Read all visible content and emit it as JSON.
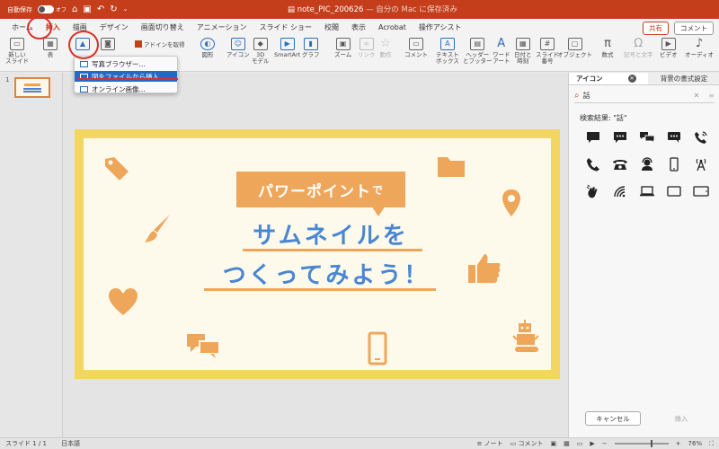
{
  "titlebar": {
    "autosave_label": "自動保存",
    "autosave_state": "オフ",
    "doc_name": "note_PIC_200626",
    "doc_status": "— 自分の Mac に保存済み"
  },
  "menu": {
    "tabs": [
      "ホーム",
      "挿入",
      "描画",
      "デザイン",
      "画面切り替え",
      "アニメーション",
      "スライド ショー",
      "校閲",
      "表示",
      "Acrobat",
      "操作アシスト"
    ],
    "active": "挿入",
    "share_label": "共有",
    "comment_label": "コメント"
  },
  "ribbon": {
    "new_slide": "新しい\nスライド",
    "table": "表",
    "addin": "アドインを取得",
    "shapes": "図形",
    "icons": "アイコン",
    "model3d": "3D\nモデル",
    "smartart": "SmartArt",
    "graph": "グラフ",
    "zoom": "ズーム",
    "link": "リンク",
    "action": "動作",
    "comment": "コメント",
    "textbox": "テキスト\nボックス",
    "header": "ヘッダー\nとフッター",
    "wordart": "ワード\nアート",
    "datetime": "日付と\n時刻",
    "slide_number": "スライド\n番号",
    "object": "オブジェクト",
    "equation": "数式",
    "symbol": "記号と文字",
    "video": "ビデオ",
    "audio": "オーディオ"
  },
  "picture_menu": {
    "items": [
      "写真ブラウザー...",
      "図をファイルから挿入...",
      "オンライン画像..."
    ],
    "highlighted": 1
  },
  "slide_panel": {
    "thumb_number": "1"
  },
  "slide": {
    "bubble_main": "パワーポイント",
    "bubble_small": "で",
    "line1": "サムネイルを",
    "line2": "つくってみよう！",
    "colors": {
      "frame": "#f2d660",
      "bg": "#fdfaec",
      "accent": "#eea65b",
      "title": "#4a86d1"
    }
  },
  "icons_pane": {
    "tab_icons": "アイコン",
    "tab_format": "背景の書式設定",
    "search_value": "話",
    "result_label": "検索結果: \"話\"",
    "icon_names": [
      "speech-bubble-solid",
      "speech-bubble-dots",
      "speech-bubbles",
      "chat-dots-bubble",
      "phone-ringing",
      "phone-handset",
      "desk-phone",
      "headset-person",
      "smartphone",
      "signal-tower",
      "hand-waving-sound",
      "wifi-signal",
      "laptop",
      "tablet",
      "tablet-landscape"
    ],
    "cancel_label": "キャンセル",
    "insert_label": "挿入"
  },
  "statusbar": {
    "slide_info": "スライド 1 / 1",
    "language": "日本語",
    "notes": "ノート",
    "comments": "コメント",
    "zoom": "76%"
  }
}
